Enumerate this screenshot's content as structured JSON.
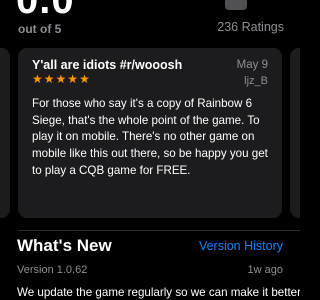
{
  "ratings": {
    "score": "0.0",
    "out_of": "out of 5",
    "count": "236 Ratings"
  },
  "review": {
    "title": "Y'all are idiots #r/wooosh",
    "date": "May 9",
    "author": "ljz_B",
    "stars": 5,
    "body": "For those who say it's a copy of Rainbow 6 Siege, that's the whole point of the game. To play it on mobile. There's no other game on mobile like this out there, so be happy you get to play a CQB game for FREE."
  },
  "whats_new": {
    "title": "What's New",
    "history_link": "Version History",
    "version": "Version 1.0.62",
    "ago": "1w ago",
    "body": "We update the game regularly so we can make it better"
  },
  "colors": {
    "background": "#000000",
    "card": "#1c1c1e",
    "star": "#ff9500",
    "link": "#0a84ff",
    "secondary_text": "#8e8e93"
  }
}
